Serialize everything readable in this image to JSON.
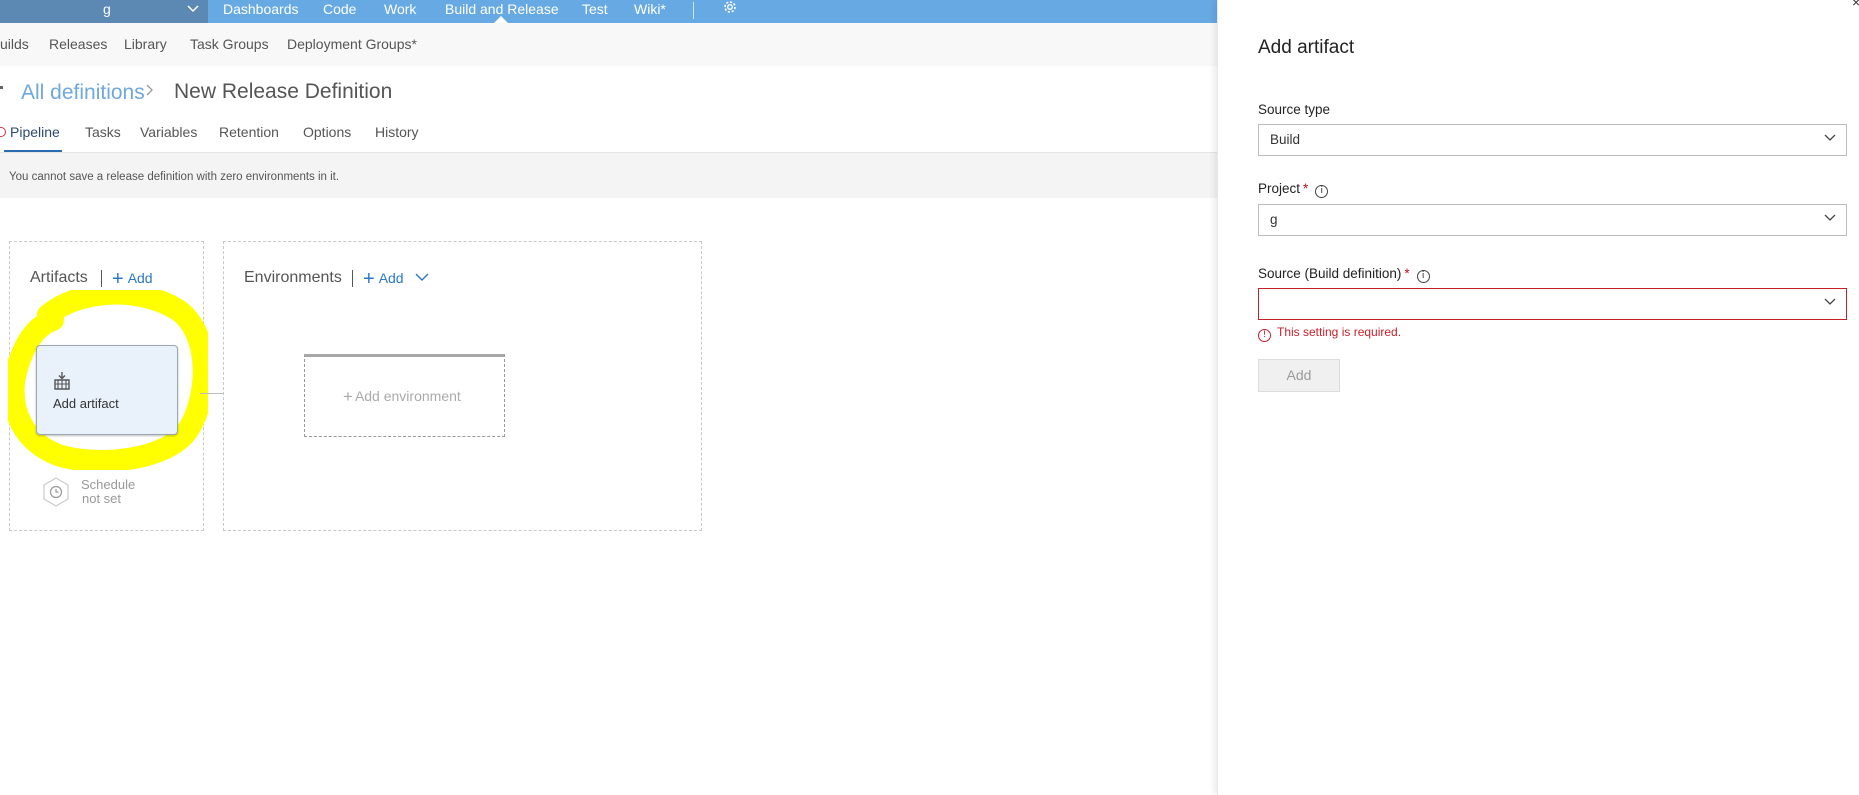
{
  "topnav": {
    "project": "g",
    "items": [
      "Dashboards",
      "Code",
      "Work",
      "Build and Release",
      "Test",
      "Wiki*"
    ]
  },
  "subnav": {
    "items": [
      "uilds",
      "Releases",
      "Library",
      "Task Groups",
      "Deployment Groups*"
    ]
  },
  "breadcrumb": {
    "link": "All definitions",
    "title": "New Release Definition"
  },
  "tabs": [
    "Pipeline",
    "Tasks",
    "Variables",
    "Retention",
    "Options",
    "History"
  ],
  "message": "You cannot save a release definition with zero environments in it.",
  "artifacts": {
    "title": "Artifacts",
    "add_label": "Add",
    "card_label": "Add artifact",
    "schedule_line1": "Schedule",
    "schedule_line2": "not set"
  },
  "environments": {
    "title": "Environments",
    "add_label": "Add",
    "card_label": "Add environment"
  },
  "panel": {
    "title": "Add artifact",
    "source_type_label": "Source type",
    "source_type_value": "Build",
    "project_label": "Project",
    "project_value": "g",
    "source_label": "Source (Build definition)",
    "source_value": "",
    "error": "This setting is required.",
    "add_button": "Add",
    "close": "×"
  },
  "colors": {
    "topbar": "#67a9e3",
    "accent": "#2b78c5",
    "error": "#c51f2b",
    "highlight": "#ffff00"
  }
}
